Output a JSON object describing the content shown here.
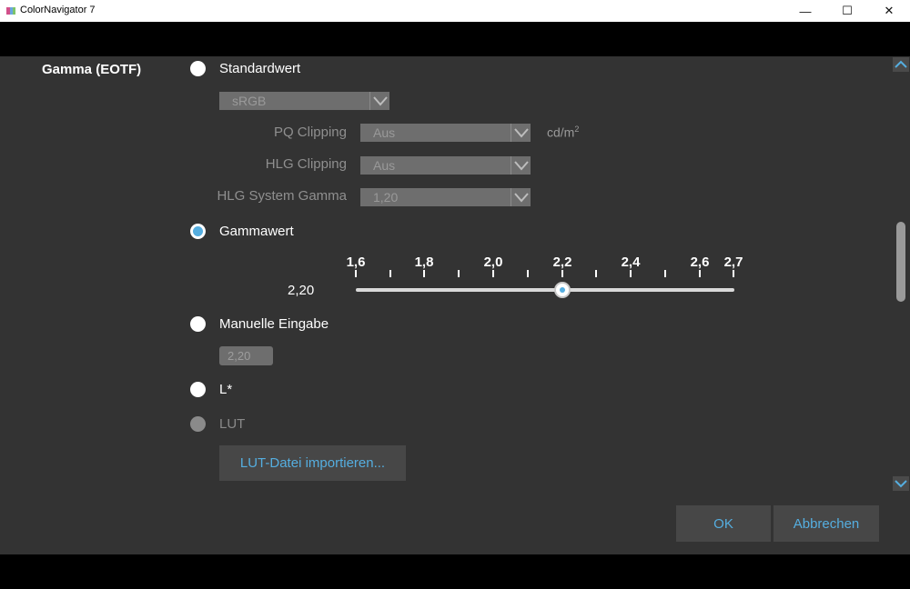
{
  "window": {
    "title": "ColorNavigator 7",
    "minimize_icon": "—",
    "maximize_icon": "☐",
    "close_icon": "✕"
  },
  "gamma": {
    "section_label": "Gamma (EOTF)",
    "options": {
      "standard": {
        "label": "Standardwert",
        "selected": false
      },
      "gammawert": {
        "label": "Gammawert",
        "selected": true
      },
      "manual": {
        "label": "Manuelle Eingabe",
        "selected": false
      },
      "lstar": {
        "label": "L*",
        "selected": false
      },
      "lut": {
        "label": "LUT",
        "selected": false,
        "disabled": true
      }
    },
    "standard_dropdown": {
      "value": "sRGB"
    },
    "pq_clipping": {
      "label": "PQ Clipping",
      "value": "Aus",
      "unit": "cd/m",
      "unit_sup": "2"
    },
    "hlg_clipping": {
      "label": "HLG Clipping",
      "value": "Aus"
    },
    "hlg_system_gamma": {
      "label": "HLG System Gamma",
      "value": "1,20"
    },
    "slider": {
      "value_text": "2,20",
      "min": 1.6,
      "max": 2.7,
      "value": 2.2,
      "tick_labels": [
        "1,6",
        "1,8",
        "2,0",
        "2,2",
        "2,4",
        "2,6",
        "2,7"
      ]
    },
    "manual_input": {
      "value": "2,20"
    },
    "lut_import_button": "LUT-Datei importieren..."
  },
  "footer": {
    "ok_label": "OK",
    "cancel_label": "Abbrechen"
  },
  "colors": {
    "panel_bg": "#333333",
    "accent": "#55aee0",
    "button_bg": "#474747"
  }
}
